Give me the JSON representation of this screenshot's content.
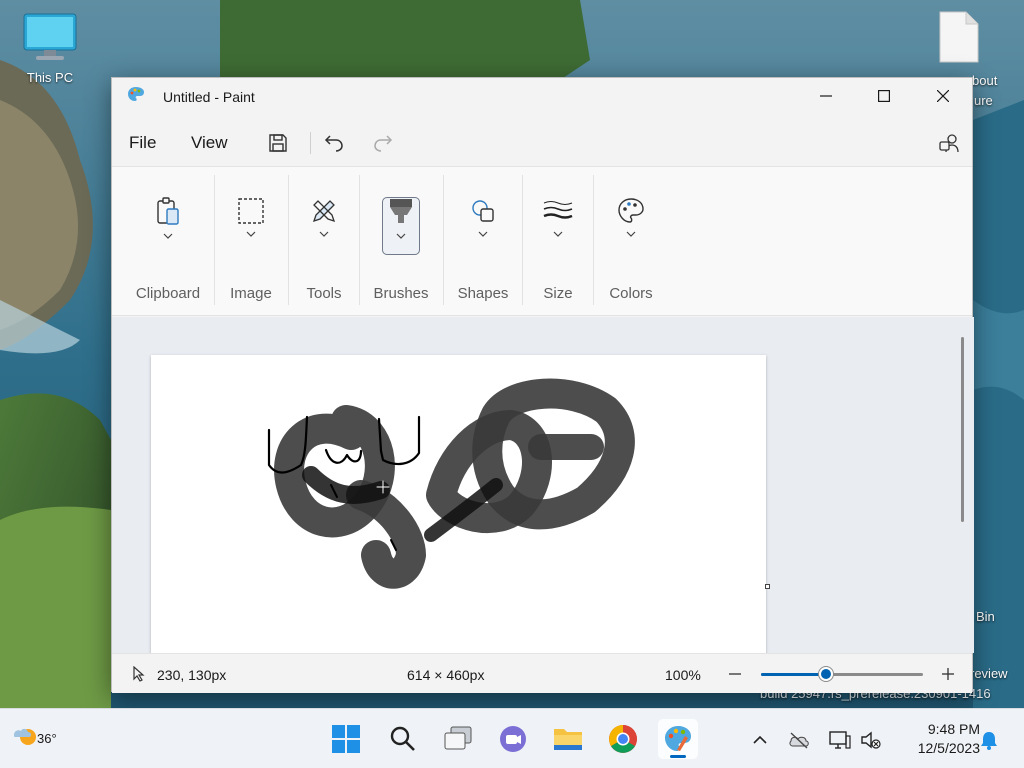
{
  "desktop": {
    "icons": [
      {
        "label": "This PC"
      }
    ],
    "partial_labels": [
      "bout",
      "ure",
      "Bin",
      "review",
      "build 25947.rs_prerelease.230901-1416"
    ]
  },
  "window": {
    "title": "Untitled - Paint",
    "menu": {
      "file": "File",
      "view": "View"
    },
    "ribbon": {
      "groups": [
        {
          "label": "Clipboard"
        },
        {
          "label": "Image"
        },
        {
          "label": "Tools"
        },
        {
          "label": "Brushes"
        },
        {
          "label": "Shapes"
        },
        {
          "label": "Size"
        },
        {
          "label": "Colors"
        }
      ],
      "selected_group": "Brushes"
    },
    "status": {
      "cursor_position": "230, 130px",
      "canvas_size": "614 × 460px",
      "zoom": "100%",
      "zoom_level_fraction": 0.4
    }
  },
  "taskbar": {
    "weather_temp": "36°",
    "time": "9:48 PM",
    "date": "12/5/2023",
    "apps": [
      "start-icon",
      "search-icon",
      "task-view-icon",
      "teams-icon",
      "file-explorer-icon",
      "chrome-icon",
      "paint-icon"
    ],
    "active_app": "paint-icon"
  },
  "colors": {
    "accent": "#0063b1",
    "taskbar": "#eff2f6",
    "window": "#f3f3f3",
    "stroke_dark": "#000000",
    "stroke_gray": "#3a3a3a"
  }
}
